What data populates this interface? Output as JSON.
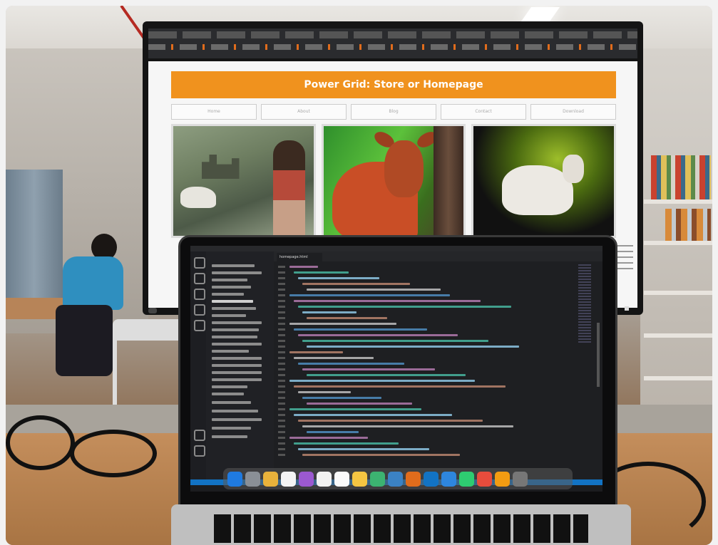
{
  "monitor": {
    "banner_title": "Power Grid: Store or Homepage",
    "nav_items": [
      "Home",
      "About",
      "Blog",
      "Contact",
      "Download"
    ]
  },
  "laptop": {
    "editor_tab": "homepage.html"
  },
  "palette": {
    "banner": "#f0921e",
    "vscode_status": "#1273c4",
    "desk": "#c48e5c"
  }
}
